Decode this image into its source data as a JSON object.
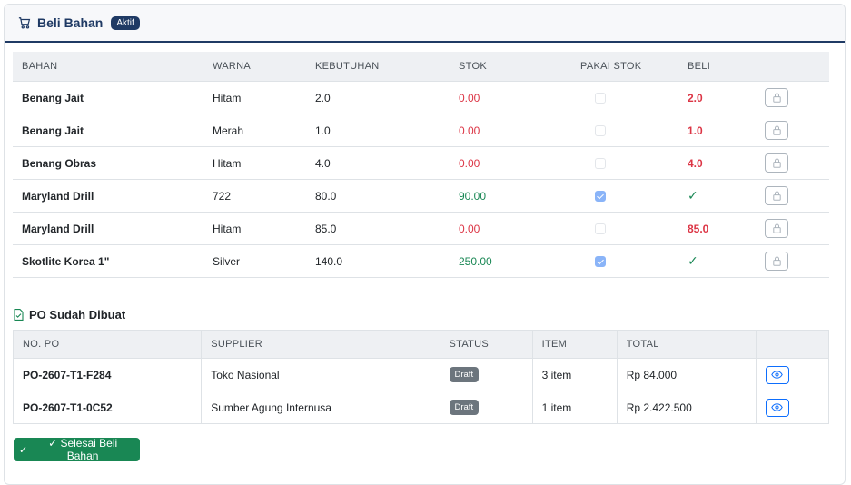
{
  "header": {
    "title": "Beli Bahan",
    "status_badge": "Aktif"
  },
  "bahan_table": {
    "columns": [
      "BAHAN",
      "WARNA",
      "KEBUTUHAN",
      "STOK",
      "PAKAI STOK",
      "BELI"
    ],
    "rows": [
      {
        "bahan": "Benang Jait",
        "warna": "Hitam",
        "kebutuhan": "2.0",
        "stok": "0.00",
        "stok_color": "red",
        "pakai_stok": false,
        "beli": "2.0"
      },
      {
        "bahan": "Benang Jait",
        "warna": "Merah",
        "kebutuhan": "1.0",
        "stok": "0.00",
        "stok_color": "red",
        "pakai_stok": false,
        "beli": "1.0"
      },
      {
        "bahan": "Benang Obras",
        "warna": "Hitam",
        "kebutuhan": "4.0",
        "stok": "0.00",
        "stok_color": "red",
        "pakai_stok": false,
        "beli": "4.0"
      },
      {
        "bahan": "Maryland Drill",
        "warna": "722",
        "kebutuhan": "80.0",
        "stok": "90.00",
        "stok_color": "green",
        "pakai_stok": true,
        "beli": "✓"
      },
      {
        "bahan": "Maryland Drill",
        "warna": "Hitam",
        "kebutuhan": "85.0",
        "stok": "0.00",
        "stok_color": "red",
        "pakai_stok": false,
        "beli": "85.0"
      },
      {
        "bahan": "Skotlite Korea 1\"",
        "warna": "Silver",
        "kebutuhan": "140.0",
        "stok": "250.00",
        "stok_color": "green",
        "pakai_stok": true,
        "beli": "✓"
      }
    ],
    "row_action_icon": "lock-icon"
  },
  "po_section": {
    "title": "PO Sudah Dibuat",
    "columns": [
      "NO. PO",
      "SUPPLIER",
      "STATUS",
      "ITEM",
      "TOTAL"
    ],
    "rows": [
      {
        "no_po": "PO-2607-T1-F284",
        "supplier": "Toko Nasional",
        "status": "Draft",
        "item": "3 item",
        "total": "Rp 84.000"
      },
      {
        "no_po": "PO-2607-T1-0C52",
        "supplier": "Sumber Agung Internusa",
        "status": "Draft",
        "item": "1 item",
        "total": "Rp 2.422.500"
      }
    ],
    "row_action_icon": "eye-icon"
  },
  "finish_button": {
    "label": "✓ Selesai Beli Bahan"
  },
  "colors": {
    "primary": "#1f3a64",
    "danger": "#dc3545",
    "success": "#198754",
    "info": "#0d6efd",
    "secondary": "#6c757d"
  }
}
